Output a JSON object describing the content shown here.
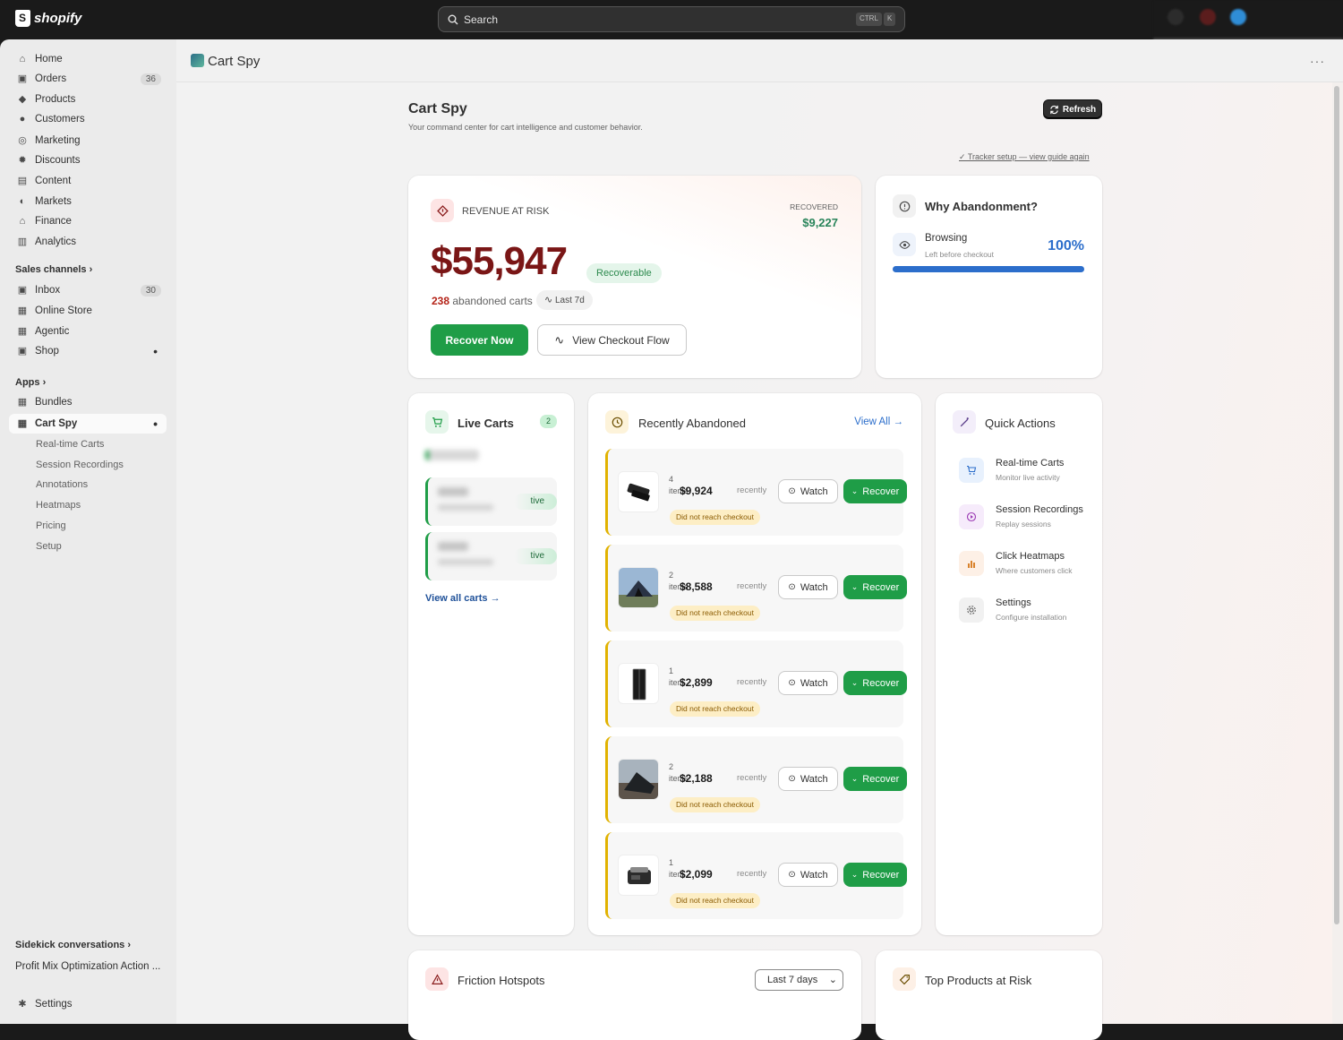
{
  "topbar": {
    "brand": "shopify",
    "search_placeholder": "Search",
    "kbd1": "CTRL",
    "kbd2": "K"
  },
  "sidebar": {
    "items": [
      {
        "label": "Home",
        "icon": "home-icon"
      },
      {
        "label": "Orders",
        "icon": "orders-icon",
        "badge": "36"
      },
      {
        "label": "Products",
        "icon": "tag-icon"
      },
      {
        "label": "Customers",
        "icon": "person-icon"
      },
      {
        "label": "Marketing",
        "icon": "target-icon"
      },
      {
        "label": "Discounts",
        "icon": "discount-icon"
      },
      {
        "label": "Content",
        "icon": "content-icon"
      },
      {
        "label": "Markets",
        "icon": "globe-icon"
      },
      {
        "label": "Finance",
        "icon": "bank-icon"
      },
      {
        "label": "Analytics",
        "icon": "chart-icon"
      }
    ],
    "sales_channels_label": "Sales channels",
    "channels": [
      {
        "label": "Inbox",
        "badge": "30"
      },
      {
        "label": "Online Store"
      },
      {
        "label": "Agentic"
      },
      {
        "label": "Shop"
      }
    ],
    "apps_label": "Apps",
    "apps": [
      {
        "label": "Bundles"
      },
      {
        "label": "Cart Spy"
      }
    ],
    "sub_items": [
      "Real-time Carts",
      "Session Recordings",
      "Annotations",
      "Heatmaps",
      "Pricing",
      "Setup"
    ],
    "sidekick_label": "Sidekick conversations",
    "sidekick_item": "Profit Mix Optimization Action ...",
    "settings_label": "Settings"
  },
  "app_header": {
    "title": "Cart Spy",
    "more": "···"
  },
  "page": {
    "title": "Cart Spy",
    "subtitle": "Your command center for cart intelligence and customer behavior.",
    "refresh_label": "Refresh",
    "tracker_link": "✓ Tracker setup — view guide again"
  },
  "revenue": {
    "label": "REVENUE AT RISK",
    "recovered_label": "RECOVERED",
    "recovered_value": "$9,227",
    "amount": "$55,947",
    "pill": "Recoverable",
    "carts_count": "238",
    "carts_text": "abandoned carts",
    "period": "Last 7d",
    "primary_btn": "Recover Now",
    "secondary_btn": "View Checkout Flow"
  },
  "why": {
    "title": "Why Abandonment?",
    "reason": "Browsing",
    "reason_sub": "Left before checkout",
    "percent": "100%",
    "fraction": 1.0
  },
  "live": {
    "title": "Live Carts",
    "count": "2",
    "status": "tive",
    "view_all": "View all carts →"
  },
  "recent": {
    "title": "Recently Abandoned",
    "view_all": "View All →",
    "watch_label": "Watch",
    "recover_label": "Recover",
    "rows": [
      {
        "qty": "4",
        "unit": "items",
        "amount": "$9,924",
        "when": "recently",
        "tag": "Did not reach checkout"
      },
      {
        "qty": "2",
        "unit": "items",
        "amount": "$8,588",
        "when": "recently",
        "tag": "Did not reach checkout"
      },
      {
        "qty": "1",
        "unit": "item",
        "amount": "$2,899",
        "when": "recently",
        "tag": "Did not reach checkout"
      },
      {
        "qty": "2",
        "unit": "items",
        "amount": "$2,188",
        "when": "recently",
        "tag": "Did not reach checkout"
      },
      {
        "qty": "1",
        "unit": "item",
        "amount": "$2,099",
        "when": "recently",
        "tag": "Did not reach checkout"
      }
    ]
  },
  "quick_actions": {
    "title": "Quick Actions",
    "items": [
      {
        "title": "Real-time Carts",
        "sub": "Monitor live activity",
        "color": "#e8f1fd"
      },
      {
        "title": "Session Recordings",
        "sub": "Replay sessions",
        "color": "#f6ebfb"
      },
      {
        "title": "Click Heatmaps",
        "sub": "Where customers click",
        "color": "#fdf0e6"
      },
      {
        "title": "Settings",
        "sub": "Configure installation",
        "color": "#f1f1f1"
      }
    ]
  },
  "friction": {
    "title": "Friction Hotspots",
    "range": "Last 7 days"
  },
  "top_products": {
    "title": "Top Products at Risk"
  },
  "colors": {
    "brand_green": "#1f9d47",
    "risk_red": "#7a1616",
    "accent_blue": "#2c6ecb",
    "warning_yellow": "#e1b200"
  }
}
